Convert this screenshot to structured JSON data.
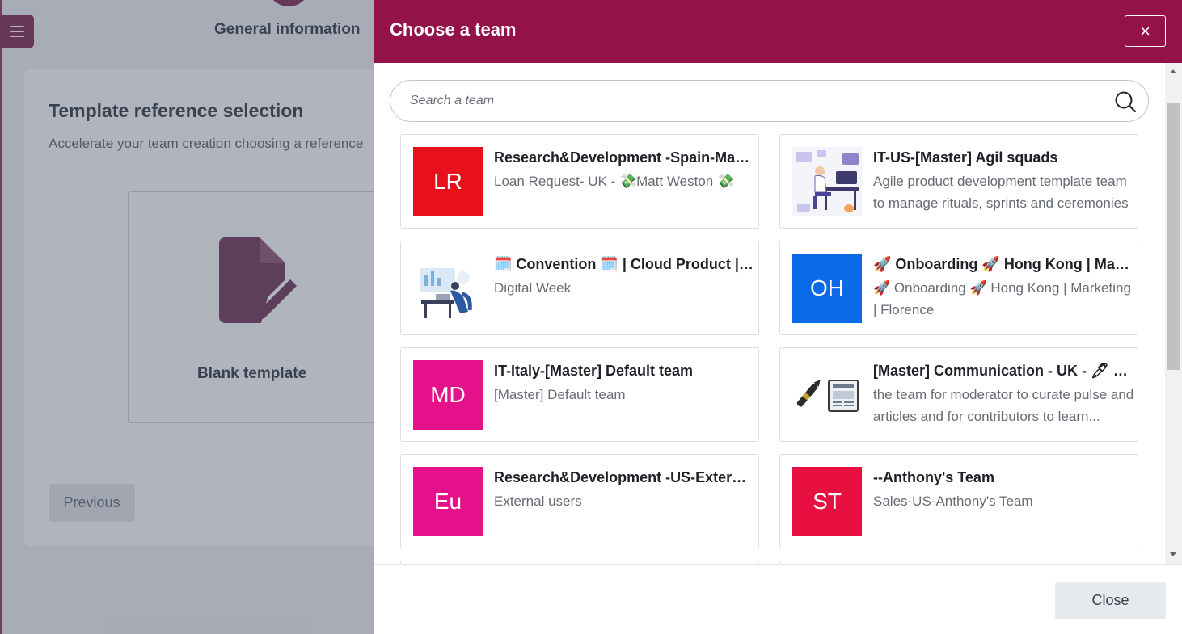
{
  "background": {
    "step_label": "General information",
    "title": "Template reference selection",
    "subtitle": "Accelerate your team creation choosing a reference",
    "blank_template_label": "Blank template",
    "previous_label": "Previous"
  },
  "drawer": {
    "title": "Choose a team",
    "close_x": "×",
    "search_placeholder": "Search a team",
    "close_label": "Close",
    "accent_color": "#94124a"
  },
  "teams": [
    {
      "initials": "LR",
      "color": "#e8101b",
      "title": "Research&Development -Spain-Matt Weston",
      "desc": "Loan Request- UK - 💸Matt Weston 💸"
    },
    {
      "initials": "",
      "image": "illustration-office-desk",
      "title": "IT-US-[Master] Agil squads",
      "desc": "Agile product development template team to manage rituals, sprints and ceremonies"
    },
    {
      "initials": "",
      "image": "illustration-person-laptop",
      "title": "🗓️ Convention 🗓️ | Cloud Product | Digital Week",
      "desc": "Digital Week"
    },
    {
      "initials": "OH",
      "color": "#0a6ae8",
      "title": "🚀 Onboarding 🚀 Hong Kong | Marketing | Florence",
      "desc": "🚀 Onboarding 🚀 Hong Kong | Marketing | Florence"
    },
    {
      "initials": "MD",
      "color": "#e4118a",
      "title": "IT-Italy-[Master] Default team",
      "desc": "[Master] Default team"
    },
    {
      "initials": "",
      "image": "illustration-pen-newspaper",
      "title": "[Master] Communication - UK - 🖊 Communication",
      "desc": "the team for moderator to curate pulse and articles and for contributors to learn..."
    },
    {
      "initials": "Eu",
      "color": "#e4118a",
      "title": "Research&Development -US-External users",
      "desc": "External users"
    },
    {
      "initials": "ST",
      "color": "#e81040",
      "title": "--Anthony's Team",
      "desc": "Sales-US-Anthony's Team"
    }
  ]
}
